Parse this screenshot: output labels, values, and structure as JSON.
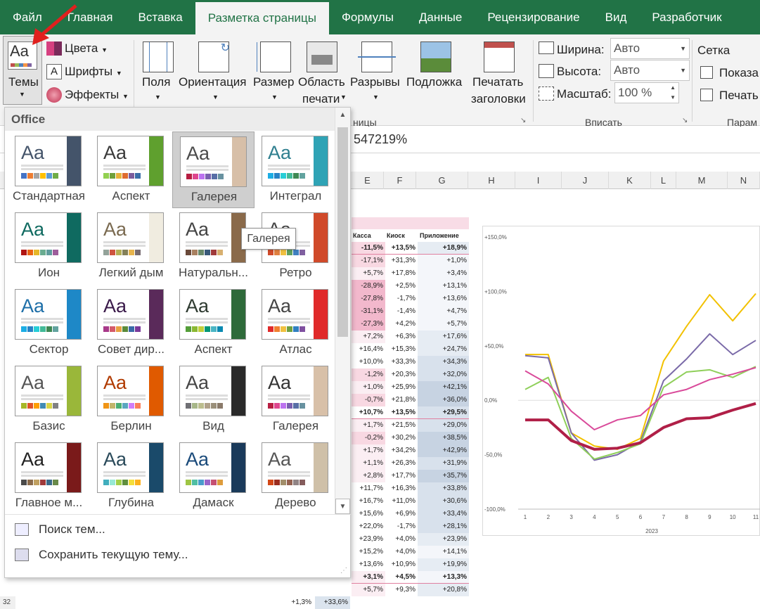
{
  "tabs": [
    "Файл",
    "Главная",
    "Вставка",
    "Разметка страницы",
    "Формулы",
    "Данные",
    "Рецензирование",
    "Вид",
    "Разработчик"
  ],
  "active_tab": "Разметка страницы",
  "ribbon": {
    "themes_btn": "Темы",
    "colors_btn": "Цвета",
    "fonts_btn": "Шрифты",
    "effects_btn": "Эффекты",
    "margins_btn": "Поля",
    "orientation_btn": "Ориентация",
    "size_btn": "Размер",
    "print_area_btn_l1": "Область",
    "print_area_btn_l2": "печати",
    "breaks_btn": "Разрывы",
    "background_btn": "Подложка",
    "print_titles_l1": "Печатать",
    "print_titles_l2": "заголовки",
    "page_setup_group_tail": "ницы",
    "width_label": "Ширина:",
    "width_value": "Авто",
    "height_label": "Высота:",
    "height_value": "Авто",
    "scale_label": "Масштаб:",
    "scale_value": "100 %",
    "fit_group": "Вписать",
    "grid_label": "Сетка",
    "show_label": "Показа",
    "print_label": "Печать",
    "params_group": "Парам"
  },
  "formula_value": "547219%",
  "columns": [
    "E",
    "F",
    "G",
    "H",
    "I",
    "J",
    "K",
    "L",
    "M",
    "N"
  ],
  "table": {
    "headers": [
      "Касса",
      "Киоск",
      "Приложение"
    ],
    "rows": [
      [
        "-11,5%",
        "+13,5%",
        "+18,9%"
      ],
      [
        "-17,1%",
        "+31,3%",
        "+1,0%"
      ],
      [
        "+5,7%",
        "+17,8%",
        "+3,4%"
      ],
      [
        "-28,9%",
        "+2,5%",
        "+13,1%"
      ],
      [
        "-27,8%",
        "-1,7%",
        "+13,6%"
      ],
      [
        "-31,1%",
        "-1,4%",
        "+4,7%"
      ],
      [
        "-27,3%",
        "+4,2%",
        "+5,7%"
      ],
      [
        "+7,2%",
        "+6,3%",
        "+17,6%"
      ],
      [
        "+16,4%",
        "+15,3%",
        "+24,7%"
      ],
      [
        "+10,0%",
        "+33,3%",
        "+34,3%"
      ],
      [
        "-1,2%",
        "+20,3%",
        "+32,0%"
      ],
      [
        "+1,0%",
        "+25,9%",
        "+42,1%"
      ],
      [
        "-0,7%",
        "+21,8%",
        "+36,0%"
      ],
      [
        "+10,7%",
        "+13,5%",
        "+29,5%"
      ],
      [
        "+1,7%",
        "+21,5%",
        "+29,0%"
      ],
      [
        "-0,2%",
        "+30,2%",
        "+38,5%"
      ],
      [
        "+1,7%",
        "+34,2%",
        "+42,9%"
      ],
      [
        "+1,1%",
        "+26,3%",
        "+31,9%"
      ],
      [
        "+2,8%",
        "+17,7%",
        "+35,7%"
      ],
      [
        "+11,7%",
        "+16,3%",
        "+33,8%"
      ],
      [
        "+16,7%",
        "+11,0%",
        "+30,6%"
      ],
      [
        "+15,6%",
        "+6,9%",
        "+33,4%"
      ],
      [
        "+22,0%",
        "-1,7%",
        "+28,1%"
      ],
      [
        "+23,9%",
        "+4,0%",
        "+23,9%"
      ],
      [
        "+15,2%",
        "+4,0%",
        "+14,1%"
      ],
      [
        "+13,6%",
        "+10,9%",
        "+19,9%"
      ],
      [
        "+3,1%",
        "+4,5%",
        "+13,3%"
      ],
      [
        "+5,7%",
        "+9,3%",
        "+20,8%"
      ]
    ],
    "bold_rows": [
      0,
      13,
      26
    ],
    "last_row": {
      "row_num": "32",
      "b": "+1,3%",
      "c": "+33,6%"
    }
  },
  "chart_data": {
    "type": "line",
    "categories": [
      "1",
      "2",
      "3",
      "4",
      "5",
      "6",
      "7",
      "8",
      "9",
      "10",
      "11"
    ],
    "xlabel": "2023",
    "ylim": [
      -100,
      150
    ],
    "yticks": [
      "+150,0%",
      "+100,0%",
      "+50,0%",
      "0,0%",
      "-50,0%",
      "-100,0%"
    ],
    "series": [
      {
        "color": "#f2c100",
        "values": [
          42,
          42,
          -30,
          -42,
          -45,
          -35,
          36,
          68,
          97,
          73,
          98
        ]
      },
      {
        "color": "#7a6aa8",
        "values": [
          41,
          39,
          -30,
          -55,
          -50,
          -38,
          18,
          38,
          61,
          42,
          55
        ]
      },
      {
        "color": "#8fcf5a",
        "values": [
          10,
          21,
          -35,
          -54,
          -48,
          -40,
          12,
          26,
          28,
          21,
          31
        ]
      },
      {
        "color": "#d94a9a",
        "values": [
          27,
          15,
          -10,
          -27,
          -18,
          -14,
          5,
          10,
          19,
          24,
          30
        ]
      },
      {
        "color": "#b01f47",
        "values": [
          -18,
          -18,
          -37,
          -45,
          -44,
          -39,
          -25,
          -17,
          -16,
          -9,
          -3
        ]
      }
    ]
  },
  "themes_panel": {
    "header": "Office",
    "items": [
      {
        "label": "Стандартная",
        "accent": "#44546a",
        "title_color": "#44546a",
        "sw": [
          "#4472c4",
          "#ed7d31",
          "#a5a5a5",
          "#ffc000",
          "#5b9bd5",
          "#70ad47"
        ]
      },
      {
        "label": "Аспект",
        "accent": "#5fa02e",
        "title_color": "#3a3a3a",
        "sw": [
          "#92d050",
          "#71a03a",
          "#e8b33a",
          "#de6b2e",
          "#7b5c9c",
          "#3a6ea8"
        ]
      },
      {
        "label": "Галерея",
        "accent": "#d7bfa8",
        "title_color": "#4b4b4b",
        "sw": [
          "#b71e42",
          "#de478e",
          "#bc72f0",
          "#795faf",
          "#586ea6",
          "#6892a0"
        ]
      },
      {
        "label": "Интеграл",
        "accent": "#2fa3b5",
        "title_color": "#2f7f8f",
        "sw": [
          "#1cade4",
          "#2683c6",
          "#27ced7",
          "#42ba97",
          "#3e8853",
          "#62a39f"
        ]
      },
      {
        "label": "Ион",
        "accent": "#0f6a60",
        "title_color": "#0f6a60",
        "sw": [
          "#b01513",
          "#ea6312",
          "#e6b729",
          "#6aac90",
          "#5f9c9d",
          "#9e5e9b"
        ]
      },
      {
        "label": "Легкий дым",
        "accent": "#f0ece0",
        "title_color": "#7a6a50",
        "sw": [
          "#93a299",
          "#cf543f",
          "#b5ae53",
          "#848058",
          "#e8b54d",
          "#786c71"
        ]
      },
      {
        "label": "Натуральн...",
        "accent": "#8a6a4a",
        "title_color": "#444",
        "sw": [
          "#6a4a3a",
          "#a88060",
          "#6a8a6a",
          "#3a5a7a",
          "#a03a3a",
          "#d8b070"
        ]
      },
      {
        "label": "Ретро",
        "accent": "#d04a2a",
        "title_color": "#444",
        "sw": [
          "#d04a2a",
          "#e08040",
          "#f0c040",
          "#60a060",
          "#4080c0",
          "#8060a0"
        ]
      },
      {
        "label": "Сектор",
        "accent": "#1e88c7",
        "title_color": "#1e6fa8",
        "sw": [
          "#1cade4",
          "#2683c6",
          "#27ced7",
          "#42ba97",
          "#3e8853",
          "#62a39f"
        ]
      },
      {
        "label": "Совет дир...",
        "accent": "#5a2a5a",
        "title_color": "#3a1a4a",
        "sw": [
          "#a83a8a",
          "#d45a6a",
          "#e8a040",
          "#5a8a3a",
          "#3a6aa8",
          "#7a3a9a"
        ]
      },
      {
        "label": "Аспект",
        "accent": "#2e6a3a",
        "title_color": "#2e3a30",
        "sw": [
          "#549e39",
          "#8ab833",
          "#c0cf3a",
          "#029676",
          "#4ab5c4",
          "#0989b1"
        ]
      },
      {
        "label": "Атлас",
        "accent": "#e02a2a",
        "title_color": "#444",
        "sw": [
          "#e02a2a",
          "#f08030",
          "#f0c040",
          "#70a040",
          "#3080c0",
          "#8050a0"
        ]
      },
      {
        "label": "Базис",
        "accent": "#9ab73a",
        "title_color": "#555",
        "sw": [
          "#a6b727",
          "#df5327",
          "#fe9e00",
          "#418ab3",
          "#d7d447",
          "#818183"
        ]
      },
      {
        "label": "Берлин",
        "accent": "#e05a00",
        "title_color": "#b03a00",
        "sw": [
          "#f09415",
          "#c1b56b",
          "#4baf73",
          "#5aa6c0",
          "#d17df9",
          "#fa7e5c"
        ]
      },
      {
        "label": "Вид",
        "accent": "#2a2a2a",
        "title_color": "#444",
        "sw": [
          "#6f6f74",
          "#a7b789",
          "#bcbd8e",
          "#b0a18a",
          "#9a8f7a",
          "#8a7a6a"
        ]
      },
      {
        "label": "Галерея",
        "accent": "#d8c0a8",
        "title_color": "#333",
        "sw": [
          "#b71e42",
          "#de478e",
          "#bc72f0",
          "#795faf",
          "#586ea6",
          "#6892a0"
        ]
      },
      {
        "label": "Главное м...",
        "accent": "#7a1a1a",
        "title_color": "#222",
        "sw": [
          "#4a4a4a",
          "#8a6a4a",
          "#c0a060",
          "#a03a3a",
          "#3a6a8a",
          "#6a8a4a"
        ]
      },
      {
        "label": "Глубина",
        "accent": "#1a4a6a",
        "title_color": "#2a4a5a",
        "sw": [
          "#41aebd",
          "#97e9d5",
          "#a2cf49",
          "#608f3d",
          "#f4de3a",
          "#fcb11c"
        ]
      },
      {
        "label": "Дамаск",
        "accent": "#1a3a5a",
        "title_color": "#1a4a7a",
        "sw": [
          "#9ec544",
          "#50bea3",
          "#4a9ccc",
          "#9a66ca",
          "#c54f71",
          "#de9c3c"
        ]
      },
      {
        "label": "Дерево",
        "accent": "#cfc0a8",
        "title_color": "#555",
        "sw": [
          "#d34817",
          "#9b2d1f",
          "#a28e6a",
          "#956251",
          "#918485",
          "#855d5d"
        ]
      }
    ],
    "tooltip": "Галерея",
    "search_themes": "Поиск тем...",
    "save_theme": "Сохранить текущую тему..."
  }
}
